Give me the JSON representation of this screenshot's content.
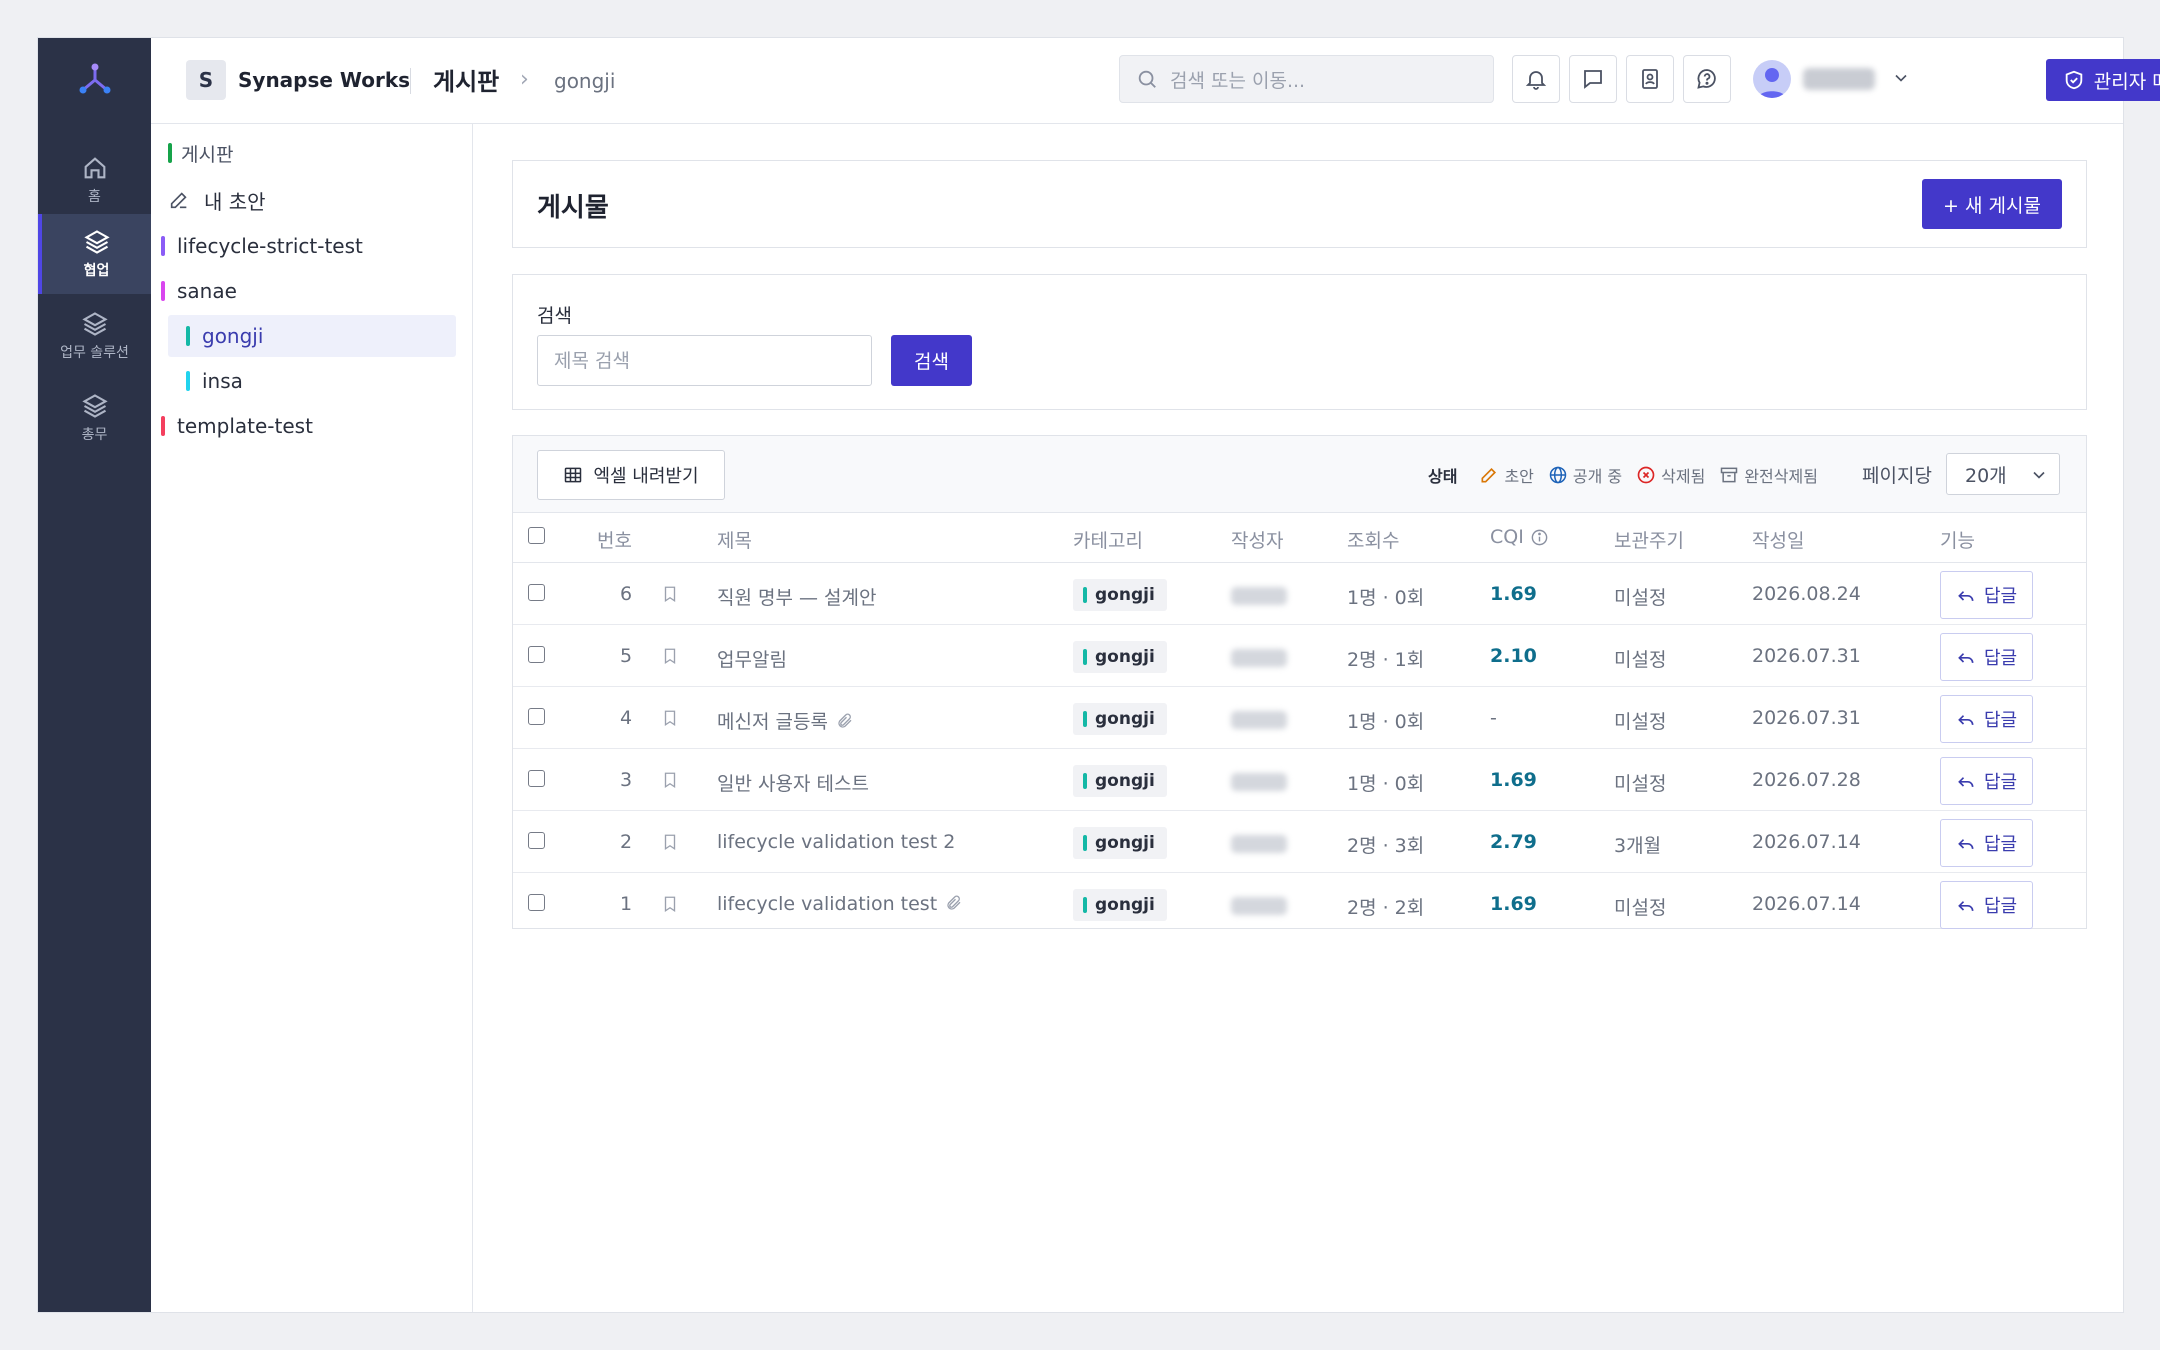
{
  "app": {
    "logo_letter": "S",
    "name": "Synapse Works"
  },
  "header": {
    "title": "게시판",
    "breadcrumb": "gongji",
    "search_placeholder": "검색 또는 이동...",
    "admin_label": "관리자 메뉴"
  },
  "rail": {
    "items": [
      {
        "label": "홈",
        "icon": "home-icon"
      },
      {
        "label": "협업",
        "icon": "layers-icon",
        "active": true
      },
      {
        "label": "업무 솔루션",
        "icon": "layers-icon"
      },
      {
        "label": "총무",
        "icon": "layers-icon"
      }
    ]
  },
  "sidebar": {
    "items": [
      {
        "label": "게시판",
        "color": "#16a34a"
      },
      {
        "label": "내 초안",
        "icon": "pencil-icon"
      },
      {
        "label": "lifecycle-strict-test",
        "color": "#8b5cf6"
      },
      {
        "label": "sanae",
        "color": "#d946ef"
      },
      {
        "label": "gongji",
        "color": "#14b8a6",
        "selected": true
      },
      {
        "label": "insa",
        "color": "#22d3ee"
      },
      {
        "label": "template-test",
        "color": "#f43f5e"
      }
    ]
  },
  "posts": {
    "title": "게시물",
    "new_button": "+ 새 게시물"
  },
  "search": {
    "label": "검색",
    "placeholder": "제목 검색",
    "button": "검색"
  },
  "toolbar": {
    "excel_button": "엑셀 내려받기",
    "status_label": "상태",
    "legend": [
      {
        "label": "초안",
        "color": "#d97706"
      },
      {
        "label": "공개 중",
        "color": "#1e63b8"
      },
      {
        "label": "삭제됨",
        "color": "#dc2626"
      },
      {
        "label": "완전삭제됨",
        "color": "#6b7280"
      }
    ],
    "per_page_label": "페이지당",
    "per_page_value": "20개"
  },
  "table": {
    "columns": [
      "번호",
      "제목",
      "카테고리",
      "작성자",
      "조회수",
      "CQI",
      "보관주기",
      "작성일",
      "기능"
    ],
    "rows": [
      {
        "no": "6",
        "title": "직원 명부 — 설계안",
        "attachment": false,
        "category": "gongji",
        "views": "1명 · 0회",
        "cqi": "1.69",
        "retention": "미설정",
        "date": "2026.08.24",
        "action": "답글"
      },
      {
        "no": "5",
        "title": "업무알림",
        "attachment": false,
        "category": "gongji",
        "views": "2명 · 1회",
        "cqi": "2.10",
        "retention": "미설정",
        "date": "2026.07.31",
        "action": "답글"
      },
      {
        "no": "4",
        "title": "메신저 글등록",
        "attachment": true,
        "category": "gongji",
        "views": "1명 · 0회",
        "cqi": "-",
        "retention": "미설정",
        "date": "2026.07.31",
        "action": "답글"
      },
      {
        "no": "3",
        "title": "일반 사용자 테스트",
        "attachment": false,
        "category": "gongji",
        "views": "1명 · 0회",
        "cqi": "1.69",
        "retention": "미설정",
        "date": "2026.07.28",
        "action": "답글"
      },
      {
        "no": "2",
        "title": "lifecycle validation test 2",
        "attachment": false,
        "category": "gongji",
        "views": "2명 · 3회",
        "cqi": "2.79",
        "retention": "3개월",
        "date": "2026.07.14",
        "action": "답글"
      },
      {
        "no": "1",
        "title": "lifecycle validation test",
        "attachment": true,
        "category": "gongji",
        "views": "2명 · 2회",
        "cqi": "1.69",
        "retention": "미설정",
        "date": "2026.07.14",
        "action": "답글"
      }
    ]
  },
  "colors": {
    "accent": "#4338ca",
    "rail_bg": "#2b3247",
    "cqi_text": "#0f6e8c"
  }
}
